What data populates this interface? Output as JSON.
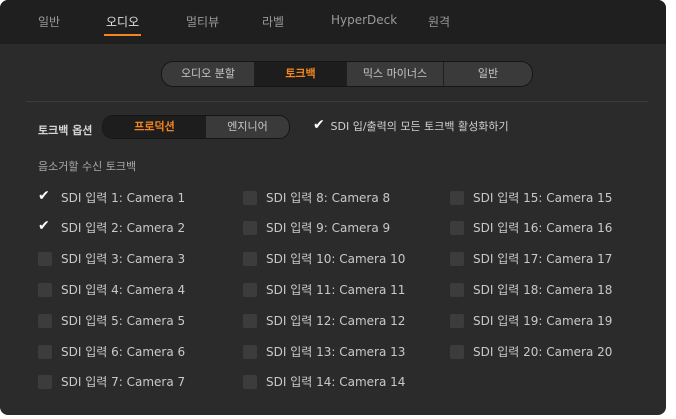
{
  "nav": {
    "tabs": [
      {
        "label": "일반",
        "active": false
      },
      {
        "label": "오디오",
        "active": true
      },
      {
        "label": "멀티뷰",
        "active": false
      },
      {
        "label": "라벨",
        "active": false
      },
      {
        "label": "HyperDeck",
        "active": false
      },
      {
        "label": "원격",
        "active": false
      }
    ]
  },
  "subtabs": [
    {
      "label": "오디오 분할",
      "active": false
    },
    {
      "label": "토크백",
      "active": true
    },
    {
      "label": "믹스 마이너스",
      "active": false
    },
    {
      "label": "일반",
      "active": false
    }
  ],
  "talkback_options": {
    "label": "토크백 옵션",
    "segments": [
      {
        "label": "프로덕션",
        "active": true
      },
      {
        "label": "엔지니어",
        "active": false
      }
    ],
    "sdi_all": {
      "label": "SDI 입/출력의 모든 토크백 활성화하기",
      "checked": true
    }
  },
  "mute_section": {
    "label": "음소거할 수신 토크백",
    "inputs": [
      {
        "label": "SDI 입력 1: Camera 1",
        "checked": true
      },
      {
        "label": "SDI 입력 2: Camera 2",
        "checked": true
      },
      {
        "label": "SDI 입력 3: Camera 3",
        "checked": false
      },
      {
        "label": "SDI 입력 4: Camera 4",
        "checked": false
      },
      {
        "label": "SDI 입력 5: Camera 5",
        "checked": false
      },
      {
        "label": "SDI 입력 6: Camera 6",
        "checked": false
      },
      {
        "label": "SDI 입력 7: Camera 7",
        "checked": false
      },
      {
        "label": "SDI 입력 8: Camera 8",
        "checked": false
      },
      {
        "label": "SDI 입력 9: Camera 9",
        "checked": false
      },
      {
        "label": "SDI 입력 10: Camera 10",
        "checked": false
      },
      {
        "label": "SDI 입력 11: Camera 11",
        "checked": false
      },
      {
        "label": "SDI 입력 12: Camera 12",
        "checked": false
      },
      {
        "label": "SDI 입력 13: Camera 13",
        "checked": false
      },
      {
        "label": "SDI 입력 14: Camera 14",
        "checked": false
      },
      {
        "label": "SDI 입력 15: Camera 15",
        "checked": false
      },
      {
        "label": "SDI 입력 16: Camera 16",
        "checked": false
      },
      {
        "label": "SDI 입력 17: Camera 17",
        "checked": false
      },
      {
        "label": "SDI 입력 18: Camera 18",
        "checked": false
      },
      {
        "label": "SDI 입력 19: Camera 19",
        "checked": false
      },
      {
        "label": "SDI 입력 20: Camera 20",
        "checked": false
      }
    ]
  },
  "colors": {
    "accent": "#f5851f",
    "background": "#2b2b2b",
    "nav_background": "#1f1f1f"
  },
  "icons": {
    "check": "checkmark-icon"
  }
}
